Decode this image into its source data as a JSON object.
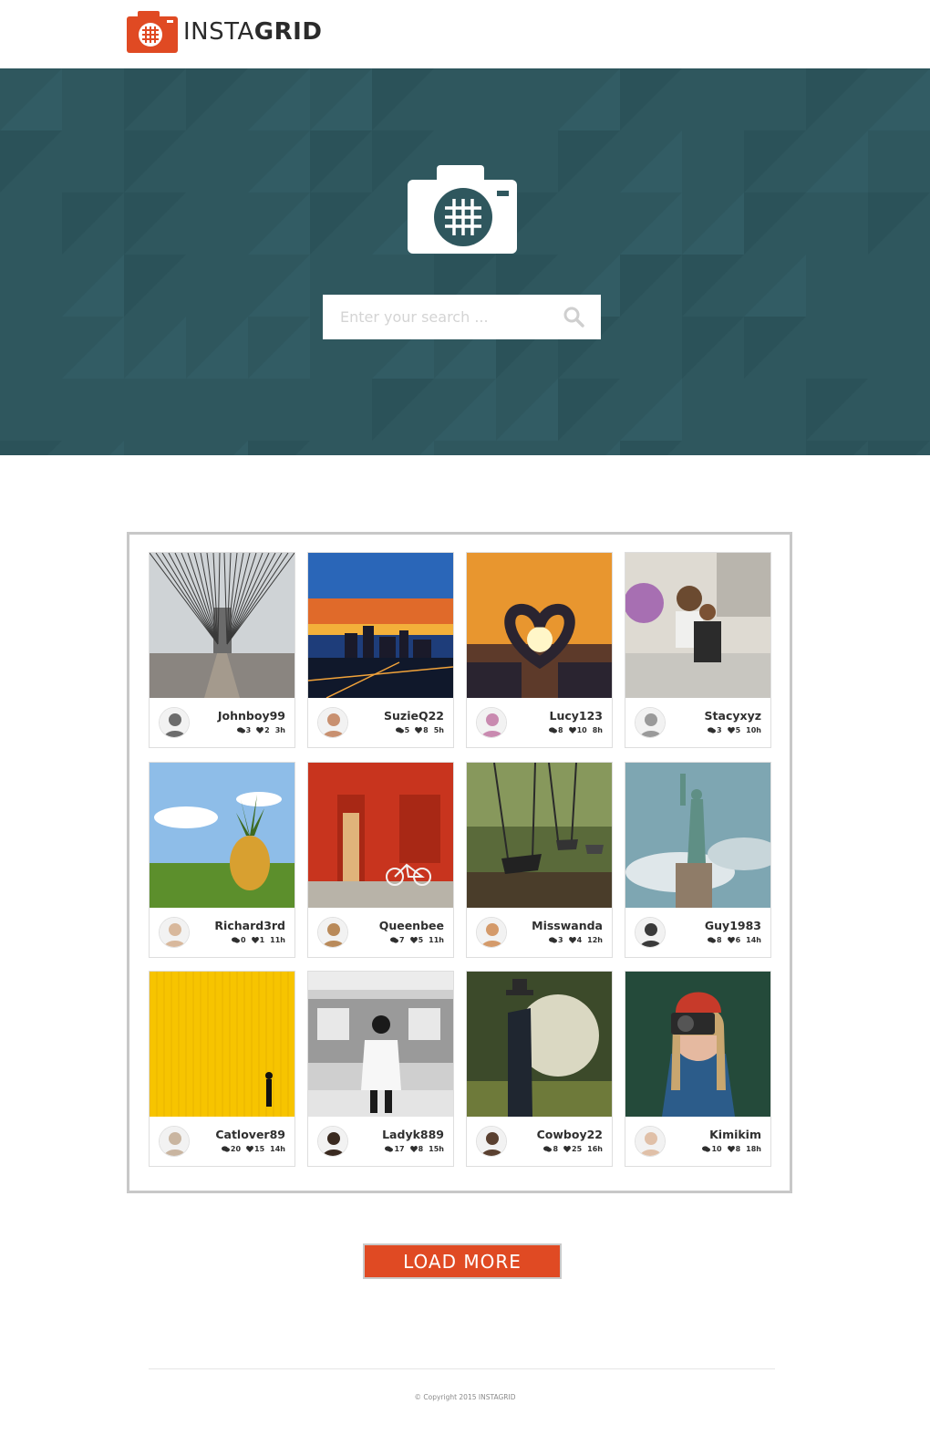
{
  "brand": {
    "name_a": "INSTA",
    "name_b": "GRID",
    "accent": "#e04a23",
    "hero_bg": "#2f575e"
  },
  "search": {
    "placeholder": "Enter your search ...",
    "icon": "search-icon"
  },
  "posts": [
    {
      "username": "Johnboy99",
      "comments": "3",
      "likes": "2",
      "age": "3h",
      "photo": "bridge"
    },
    {
      "username": "SuzieQ22",
      "comments": "5",
      "likes": "8",
      "age": "5h",
      "photo": "city-sunset"
    },
    {
      "username": "Lucy123",
      "comments": "8",
      "likes": "10",
      "age": "8h",
      "photo": "heart-hands"
    },
    {
      "username": "Stacyxyz",
      "comments": "3",
      "likes": "5",
      "age": "10h",
      "photo": "mother-child"
    },
    {
      "username": "Richard3rd",
      "comments": "0",
      "likes": "1",
      "age": "11h",
      "photo": "pineapple"
    },
    {
      "username": "Queenbee",
      "comments": "7",
      "likes": "5",
      "age": "11h",
      "photo": "red-wall-bike"
    },
    {
      "username": "Misswanda",
      "comments": "3",
      "likes": "4",
      "age": "12h",
      "photo": "swings"
    },
    {
      "username": "Guy1983",
      "comments": "8",
      "likes": "6",
      "age": "14h",
      "photo": "statue-of-liberty"
    },
    {
      "username": "Catlover89",
      "comments": "20",
      "likes": "15",
      "age": "14h",
      "photo": "yellow-wall"
    },
    {
      "username": "Ladyk889",
      "comments": "17",
      "likes": "8",
      "age": "15h",
      "photo": "subway"
    },
    {
      "username": "Cowboy22",
      "comments": "8",
      "likes": "25",
      "age": "16h",
      "photo": "cowboy-field"
    },
    {
      "username": "Kimikim",
      "comments": "10",
      "likes": "8",
      "age": "18h",
      "photo": "camera-girl"
    }
  ],
  "load_more": {
    "label": "LOAD MORE"
  },
  "footer": {
    "copyright": "© Copyright 2015 INSTAGRID"
  }
}
